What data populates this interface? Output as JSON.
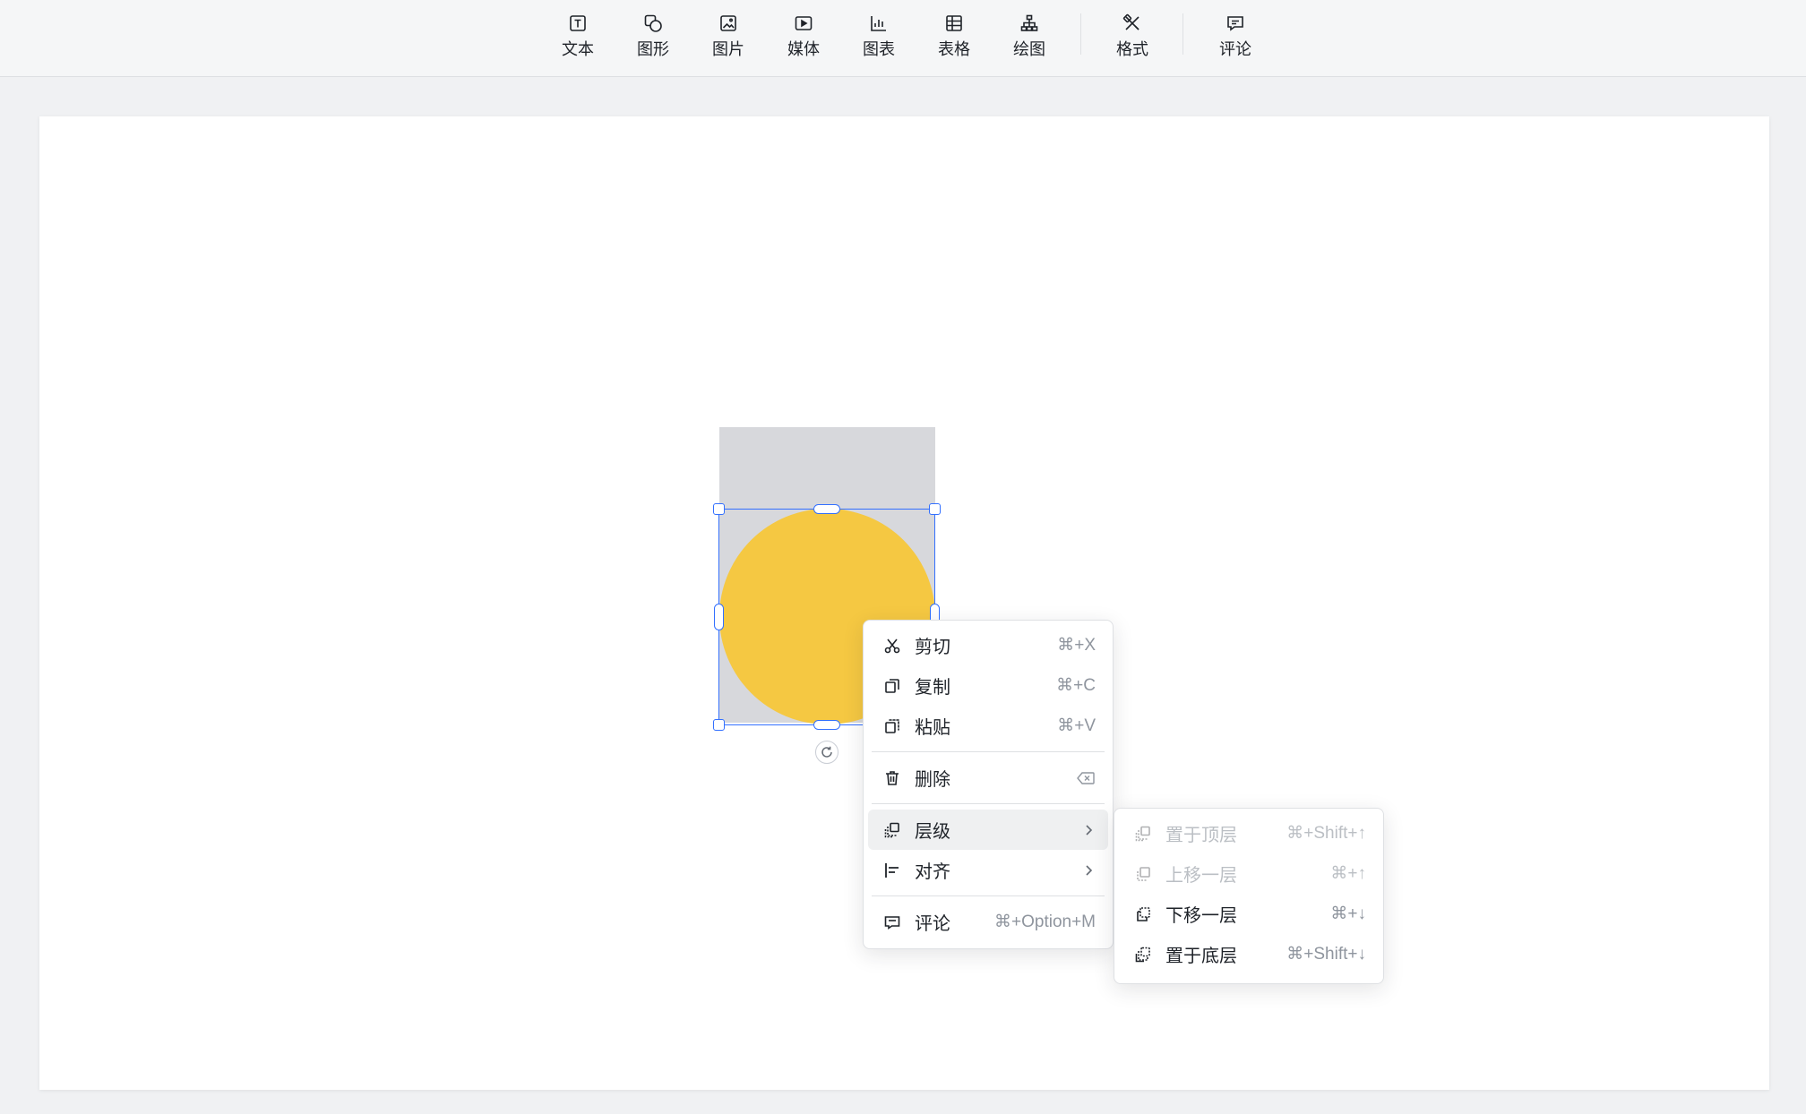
{
  "toolbar": {
    "items": [
      {
        "label": "文本",
        "icon": "text-icon"
      },
      {
        "label": "图形",
        "icon": "shape-icon"
      },
      {
        "label": "图片",
        "icon": "image-icon"
      },
      {
        "label": "媒体",
        "icon": "media-icon"
      },
      {
        "label": "图表",
        "icon": "chart-icon"
      },
      {
        "label": "表格",
        "icon": "table-icon"
      },
      {
        "label": "绘图",
        "icon": "diagram-icon"
      },
      {
        "label": "格式",
        "icon": "format-icon"
      },
      {
        "label": "评论",
        "icon": "comment-icon"
      }
    ]
  },
  "context_menu": {
    "cut": {
      "label": "剪切",
      "shortcut": "⌘+X"
    },
    "copy": {
      "label": "复制",
      "shortcut": "⌘+C"
    },
    "paste": {
      "label": "粘贴",
      "shortcut": "⌘+V"
    },
    "delete": {
      "label": "删除"
    },
    "layer": {
      "label": "层级"
    },
    "align": {
      "label": "对齐"
    },
    "comment": {
      "label": "评论",
      "shortcut": "⌘+Option+M"
    }
  },
  "layer_submenu": {
    "bring_to_front": {
      "label": "置于顶层",
      "shortcut": "⌘+Shift+↑",
      "enabled": false
    },
    "bring_forward": {
      "label": "上移一层",
      "shortcut": "⌘+↑",
      "enabled": false
    },
    "send_backward": {
      "label": "下移一层",
      "shortcut": "⌘+↓",
      "enabled": true
    },
    "send_to_back": {
      "label": "置于底层",
      "shortcut": "⌘+Shift+↓",
      "enabled": true
    }
  },
  "colors": {
    "selection": "#3370ff",
    "circle_fill": "#f5c842",
    "rect_fill": "#d7d8dc"
  }
}
